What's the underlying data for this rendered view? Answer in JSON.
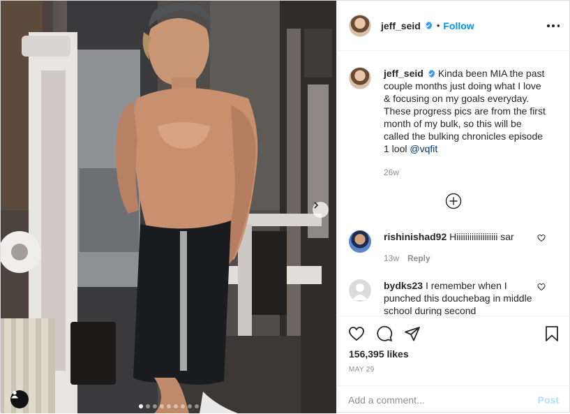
{
  "post": {
    "username": "jeff_seid",
    "separator": "•",
    "follow_label": "Follow",
    "more_options_icon": "more-horizontal-icon",
    "verified_icon": "verified-badge-icon"
  },
  "caption": {
    "username": "jeff_seid",
    "text": "Kinda been MIA the past couple months just doing what I love & focusing on my goals everyday. These progress pics are from the first month of my bulk, so this will be called the bulking chronicles episode 1 lool ",
    "mention": "@vqfit",
    "age": "26w"
  },
  "comments": [
    {
      "username": "rishinishad92",
      "text": "Hiiiiiiiiiiiiiiiiiii sar",
      "age": "13w",
      "reply_label": "Reply"
    },
    {
      "username": "bydks23",
      "text": "I remember when I punched this douchebag in middle school during second",
      "age": "",
      "reply_label": ""
    }
  ],
  "media": {
    "slide_count": 9,
    "active_slide": 1,
    "next_icon": "chevron-right-icon",
    "tag_icon": "user-tag-icon"
  },
  "actions": {
    "likes": "156,395 likes",
    "date": "MAY 29",
    "icons": [
      "heart-icon",
      "comment-icon",
      "share-icon",
      "bookmark-icon"
    ]
  },
  "add_comment": {
    "placeholder": "Add a comment...",
    "post_label": "Post"
  },
  "colors": {
    "link": "#0095f6",
    "mention": "#00376b",
    "muted": "#8e8e8e",
    "post_disabled": "#b2dffc"
  }
}
